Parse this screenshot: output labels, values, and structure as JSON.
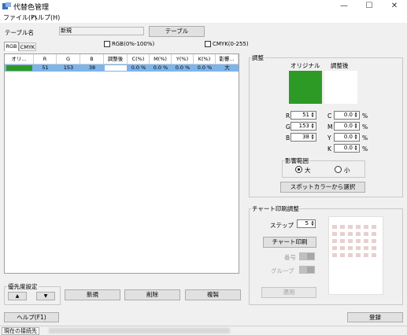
{
  "window": {
    "title": "代替色管理"
  },
  "menu": {
    "file": "ファイル(F)",
    "help": "ヘルプ(H)"
  },
  "table_name": {
    "label": "テーブル名",
    "value": "新規",
    "button": "テーブル"
  },
  "tabs": {
    "rgb": "RGB",
    "cmyk": "CMYK"
  },
  "options": {
    "rgb_percent": "RGB(0%-100%)",
    "cmyk_range": "CMYK(0-255)"
  },
  "table": {
    "columns": [
      "オリ...",
      "R",
      "G",
      "B",
      "調整後",
      "C(%)",
      "M(%)",
      "Y(%)",
      "K(%)",
      "影響..."
    ],
    "rows": [
      {
        "original_color": "#2e9a26",
        "r": "51",
        "g": "153",
        "b": "38",
        "adjusted_color": "#ffffff",
        "c": "0.0 %",
        "m": "0.0 %",
        "y": "0.0 %",
        "k": "0.0 %",
        "influence": "大"
      }
    ]
  },
  "priority": {
    "label": "優先度設定",
    "up": "▲",
    "down": "▼"
  },
  "actions": {
    "new": "新規",
    "delete": "削除",
    "copy": "複製"
  },
  "adjust": {
    "title": "調整",
    "original_label": "オリジナル",
    "adjusted_label": "調整後",
    "original_color": "#2e9a26",
    "adjusted_color": "#ffffff",
    "r_label": "R",
    "r_value": "51",
    "g_label": "G",
    "g_value": "153",
    "b_label": "B",
    "b_value": "38",
    "c_label": "C",
    "c_value": "0.0",
    "m_label": "M",
    "m_value": "0.0",
    "y_label": "Y",
    "y_value": "0.0",
    "k_label": "K",
    "k_value": "0.0",
    "percent": "%",
    "influence_title": "影響範囲",
    "influence_large": "大",
    "influence_small": "小",
    "spot_button": "スポットカラーから選択"
  },
  "chart_print": {
    "title": "チャート印刷調整",
    "step_label": "ステップ",
    "step_value": "5",
    "print_button": "チャート印刷",
    "number_label": "番号",
    "group_label": "グループ",
    "apply_button": "適用"
  },
  "footer": {
    "help_button": "ヘルプ(F1)",
    "register_button": "登録"
  },
  "status": {
    "connection_label": "現在の接続先"
  }
}
